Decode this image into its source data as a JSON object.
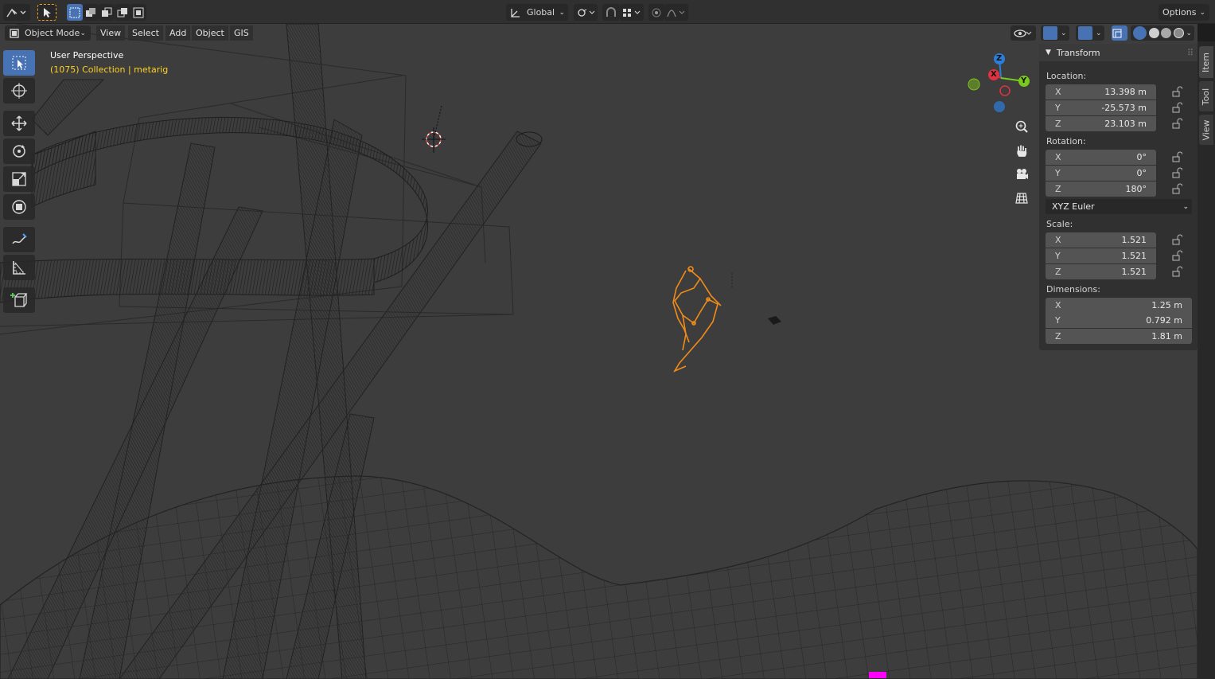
{
  "header": {
    "orientation": "Global",
    "options_label": "Options"
  },
  "viewport_header": {
    "mode": "Object Mode",
    "menus": [
      "View",
      "Select",
      "Add",
      "Object",
      "GIS"
    ]
  },
  "overlay": {
    "title": "User Perspective",
    "collection": "(1075) Collection | metarig"
  },
  "gizmo": {
    "x": "X",
    "y": "Y",
    "z": "Z"
  },
  "npanel": {
    "title": "Transform",
    "location_label": "Location:",
    "location": [
      {
        "axis": "X",
        "value": "13.398 m"
      },
      {
        "axis": "Y",
        "value": "-25.573 m"
      },
      {
        "axis": "Z",
        "value": "23.103 m"
      }
    ],
    "rotation_label": "Rotation:",
    "rotation": [
      {
        "axis": "X",
        "value": "0°"
      },
      {
        "axis": "Y",
        "value": "0°"
      },
      {
        "axis": "Z",
        "value": "180°"
      }
    ],
    "rotation_mode": "XYZ Euler",
    "scale_label": "Scale:",
    "scale": [
      {
        "axis": "X",
        "value": "1.521"
      },
      {
        "axis": "Y",
        "value": "1.521"
      },
      {
        "axis": "Z",
        "value": "1.521"
      }
    ],
    "dimensions_label": "Dimensions:",
    "dimensions": [
      {
        "axis": "X",
        "value": "1.25 m"
      },
      {
        "axis": "Y",
        "value": "0.792 m"
      },
      {
        "axis": "Z",
        "value": "1.81 m"
      }
    ]
  },
  "side_tabs": [
    "Item",
    "Tool",
    "View"
  ],
  "colors": {
    "active_blue": "#4772b3",
    "selected_orange": "#f28c18",
    "overlay_yellow": "#ffd21f",
    "axis_x": "#e0333f",
    "axis_y": "#7ac91e",
    "axis_z": "#2c7ed8"
  },
  "icons": {
    "tools": [
      "select-box-icon",
      "cursor-icon",
      "move-icon",
      "rotate-icon",
      "scale-icon",
      "transform-icon",
      "annotate-icon",
      "measure-icon",
      "add-cube-icon"
    ],
    "nav": [
      "zoom-icon",
      "pan-hand-icon",
      "camera-icon",
      "grid-view-icon"
    ]
  }
}
